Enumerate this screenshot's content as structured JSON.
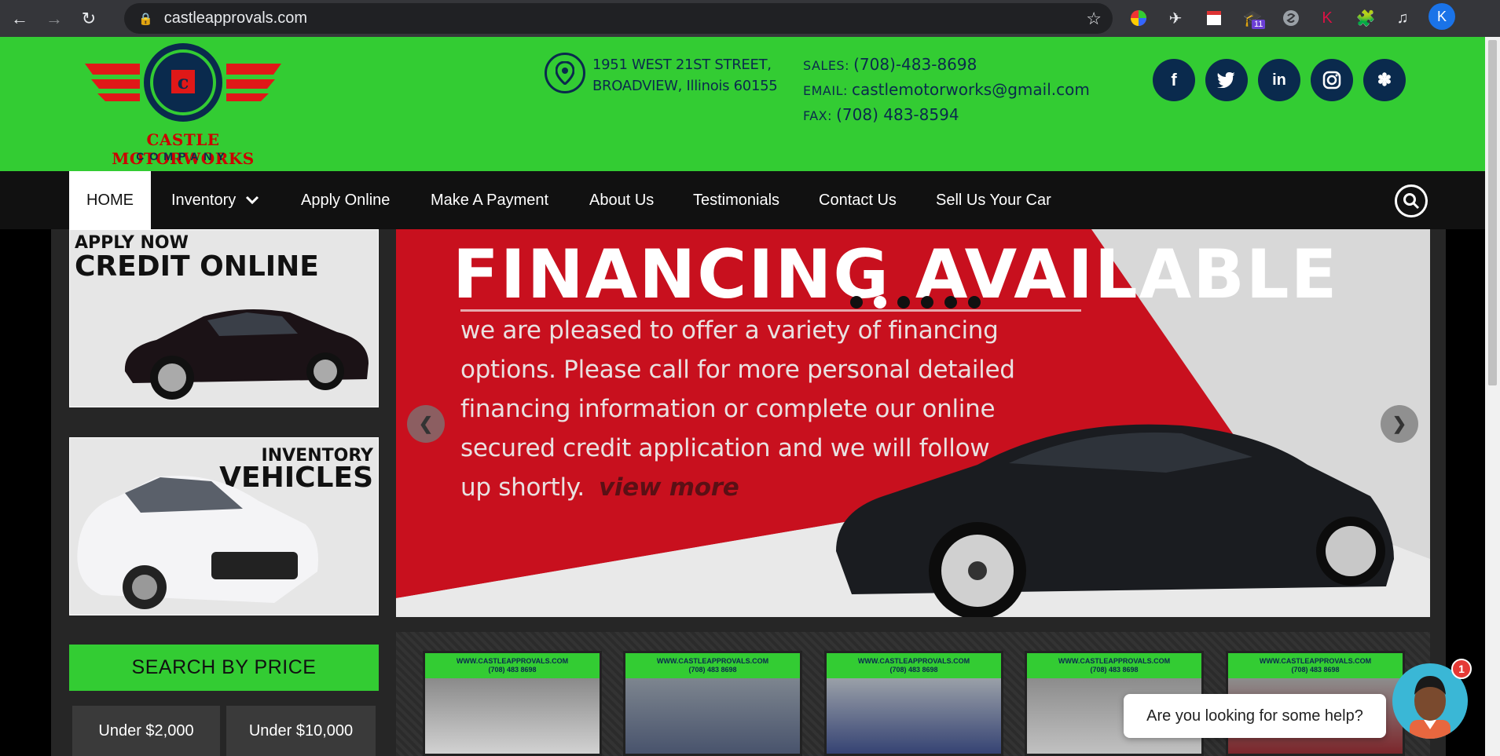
{
  "browser": {
    "url": "castleapprovals.com",
    "profile_initial": "K",
    "ext_badge": "11"
  },
  "header": {
    "logo_text": "CASTLE MOTORWORKS",
    "logo_sub": "COMPANY",
    "address_line1": "1951 WEST 21ST STREET,",
    "address_line2": "BROADVIEW, Illinois 60155",
    "sales_label": "SALES:",
    "sales_value": "(708)-483-8698",
    "email_label": "EMAIL:",
    "email_value": "castlemotorworks@gmail.com",
    "fax_label": "FAX:",
    "fax_value": "(708) 483-8594",
    "social": [
      "f",
      "t",
      "in",
      "ig",
      "yelp"
    ]
  },
  "nav": {
    "items": [
      "HOME",
      "Inventory",
      "Apply Online",
      "Make A Payment",
      "About Us",
      "Testimonials",
      "Contact Us",
      "Sell Us Your Car"
    ]
  },
  "sidebar": {
    "card1_small": "APPLY NOW",
    "card1_big": "CREDIT ONLINE",
    "card2_small": "INVENTORY",
    "card2_big": "VEHICLES",
    "search_by_price": "SEARCH BY PRICE",
    "price_options": [
      "Under $2,000",
      "Under $10,000"
    ]
  },
  "slider": {
    "title": "FINANCING AVAILABLE",
    "text": "we are pleased to offer a variety of financing options. Please call for more personal detailed financing information or complete our online secured credit application and we will follow up shortly.",
    "view_more": "view more",
    "active_dot": 1
  },
  "thumbs": {
    "header_line1": "WWW.CASTLEAPPROVALS.COM",
    "header_line2": "(708) 483 8698",
    "colors": [
      "#b8b8b8",
      "#55667a",
      "#3a4a78",
      "#a8a8a8",
      "#8a2a2a"
    ]
  },
  "chat": {
    "message": "Are you looking for some help?",
    "badge": "1"
  }
}
